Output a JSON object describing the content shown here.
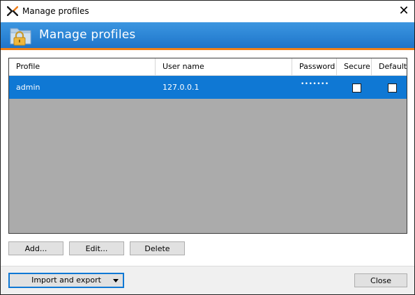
{
  "window": {
    "title": "Manage profiles"
  },
  "banner": {
    "title": "Manage profiles"
  },
  "table": {
    "columns": [
      "Profile",
      "User name",
      "Password",
      "Secure",
      "Default"
    ],
    "rows": [
      {
        "profile": "admin",
        "username": "127.0.0.1",
        "password": "•••••••",
        "secure": false,
        "default": false
      }
    ]
  },
  "buttons": {
    "add": "Add...",
    "edit": "Edit...",
    "delete": "Delete",
    "import_export": "Import and export",
    "close": "Close"
  },
  "icons": {
    "app": "app-logo-icon",
    "banner": "folder-lock-icon",
    "close": "close-icon",
    "dropdown": "chevron-down-icon"
  },
  "colors": {
    "banner": "#2d86d6",
    "accent": "#ef8019",
    "selection": "#0f78d4",
    "grid_background": "#ababab"
  }
}
